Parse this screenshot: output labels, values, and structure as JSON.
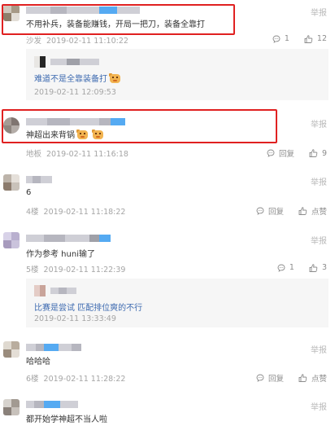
{
  "page": {
    "top_cropped_text": "作为参考 hunl输了  ...  ...  ..."
  },
  "colors": {
    "accent": "#55aaf2",
    "highlight": "#e02121",
    "reply_text": "#3d6ab0",
    "meta": "#a5a5a5"
  },
  "comments": [
    {
      "report": "举报",
      "content": "不用补兵，装备能赚钱，开局一把刀，装备全靠打",
      "floor": "沙发",
      "time": "2019-02-11 11:10:22",
      "reply_count": "1",
      "like_count": "12",
      "replies": [
        {
          "text": "难道不是全靠装备打",
          "time": "2019-02-11 12:09:53"
        }
      ]
    },
    {
      "report": "举报",
      "content": "神超出来背锅",
      "floor": "地板",
      "time": "2019-02-11 11:16:18",
      "reply_label": "回复",
      "like_count": "9"
    },
    {
      "report": "举报",
      "content": "6",
      "floor": "4楼",
      "time": "2019-02-11 11:18:22",
      "reply_label": "回复",
      "like_label": "点赞"
    },
    {
      "report": "举报",
      "content": "作为参考 huni输了",
      "floor": "5楼",
      "time": "2019-02-11 11:22:39",
      "reply_count": "1",
      "like_count": "3",
      "replies": [
        {
          "text": "比赛是尝试 匹配排位爽的不行",
          "time": "2019-02-11 13:33:49"
        }
      ]
    },
    {
      "report": "举报",
      "content": "哈哈哈",
      "floor": "6楼",
      "time": "2019-02-11 11:28:22",
      "reply_label": "回复",
      "like_label": "点赞"
    },
    {
      "report": "举报",
      "content": "都开始学神超不当人啦"
    }
  ]
}
